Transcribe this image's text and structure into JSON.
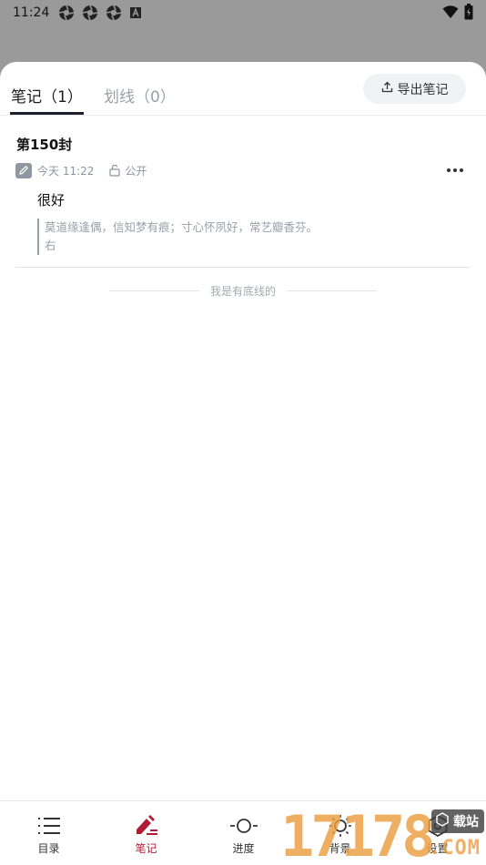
{
  "status_bar": {
    "time": "11:24",
    "icons": [
      "aperture-icon",
      "aperture-icon",
      "aperture-icon",
      "a-box-icon"
    ],
    "right_icons": [
      "wifi-icon",
      "battery-icon"
    ]
  },
  "tabs": {
    "notes_label": "笔记（1）",
    "lines_label": "划线（0）",
    "active": "notes"
  },
  "export_button": {
    "label": "导出笔记",
    "icon": "export-icon"
  },
  "note": {
    "title": "第150封",
    "time": "今天 11:22",
    "visibility": "公开",
    "text": "很好",
    "quote_line1": "莫道缘逢偶，信知梦有痕；寸心怀夙好，常艺瓣香芬。",
    "quote_line2": "右"
  },
  "bottom_line_text": "我是有底线的",
  "nav": {
    "items": [
      {
        "label": "目录",
        "icon": "list-icon"
      },
      {
        "label": "笔记",
        "icon": "note-edit-icon"
      },
      {
        "label": "进度",
        "icon": "progress-icon"
      },
      {
        "label": "背景",
        "icon": "brightness-icon"
      },
      {
        "label": "设置",
        "icon": "settings-icon"
      }
    ],
    "active": "笔记"
  },
  "watermark": {
    "digits": "17178",
    "badge": "载站",
    "suffix": ".COM"
  },
  "colors": {
    "accent": "#b01c36",
    "overlay": "#9a9a9a",
    "muted": "#9aa0a8"
  }
}
